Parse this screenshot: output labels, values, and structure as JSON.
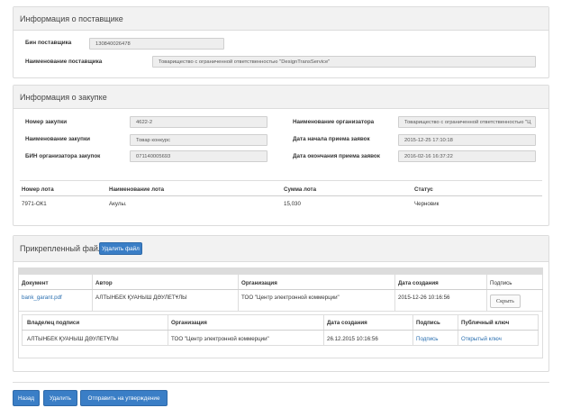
{
  "supplier": {
    "title": "Информация о поставщике",
    "bin_label": "Бин поставщика",
    "bin_value": "130840026478",
    "name_label": "Наименование поставщика",
    "name_value": "Товарищество с ограниченной ответственностью \"DesignTransService\""
  },
  "purchase": {
    "title": "Информация о закупке",
    "number_label": "Номер закупки",
    "number_value": "4622-2",
    "name_label": "Наименование закупки",
    "name_value": "Товар конкурс",
    "org_bin_label": "БИН организатора закупок",
    "org_bin_value": "071140005693",
    "org_name_label": "Наименование организатора",
    "org_name_value": "Товарищество с ограниченной ответственностью \"Ц",
    "start_label": "Дата начала приема заявок",
    "start_value": "2015-12-25 17:10:18",
    "end_label": "Дата окончания приема заявок",
    "end_value": "2016-02-16 16:37:22",
    "lots_table": {
      "headers": [
        "Номер лота",
        "Наименование лота",
        "Сумма лота",
        "Статус"
      ],
      "rows": [
        [
          "7971-ОК1",
          "Акулы.",
          "15,030",
          "Черновик"
        ]
      ]
    }
  },
  "attached": {
    "title": "Прикрепленный файл",
    "delete_file_button": "Удалить файл",
    "files_table": {
      "headers": [
        "Документ",
        "Автор",
        "Организация",
        "Дата создания",
        "Подпись"
      ],
      "row": {
        "document": "bank_garant.pdf",
        "author": "АЛТЫНБЕК ҚУАНЫШ ДӘУЛЕТҰЛЫ",
        "organization": "ТОО \"Центр электронной коммерции\"",
        "created": "2015-12-26 10:16:56",
        "hide_button": "Скрыть"
      }
    },
    "signature_table": {
      "headers": [
        "Владелец подписи",
        "Организация",
        "Дата создания",
        "Подпись",
        "Публичный ключ"
      ],
      "row": {
        "owner": "АЛТЫНБЕК ҚУАНЫШ ДӘУЛЕТҰЛЫ",
        "organization": "ТОО \"Центр электронной коммерции\"",
        "created": "26.12.2015 10:16:56",
        "signature_link": "Подпись",
        "public_key_link": "Открытый ключ"
      }
    }
  },
  "footer": {
    "back_button": "Назад",
    "delete_button": "Удалить",
    "submit_button": "Отправить на утверждение"
  },
  "colors": {
    "primary": "#3a7ec6",
    "link": "#2a6fb0",
    "panel_header": "#f2f2f2",
    "field_bg": "#eeeeee"
  }
}
